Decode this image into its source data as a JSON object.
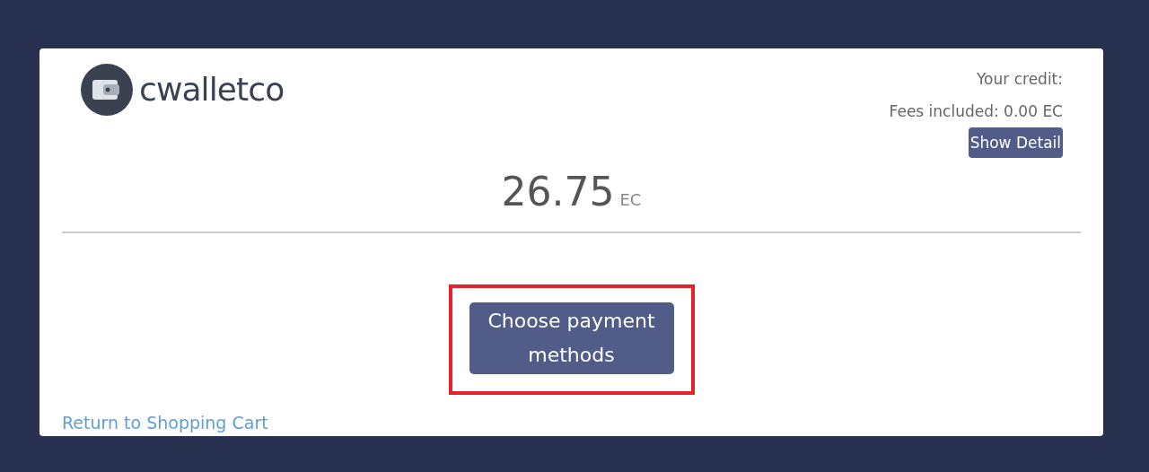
{
  "brand": {
    "name": "cwalletco"
  },
  "credit": {
    "label": "Your credit:",
    "fees": "Fees included: 0.00 EC",
    "detail_button": "Show Detail"
  },
  "amount": {
    "value": "26.75",
    "currency": "EC"
  },
  "primary_button": {
    "label": "Choose payment methods",
    "highlighted": true
  },
  "back_link": "Return to Shopping Cart"
}
